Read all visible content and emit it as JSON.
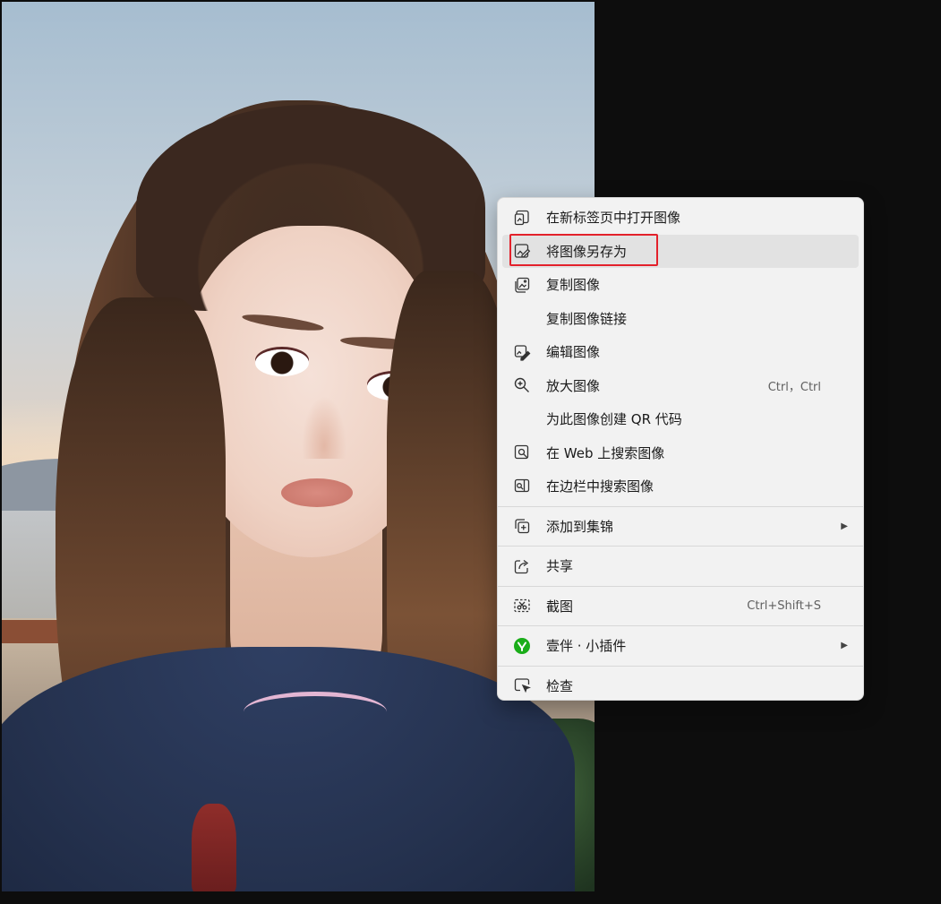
{
  "menu": {
    "items": [
      {
        "label": "在新标签页中打开图像",
        "icon": "open-new-tab-icon",
        "shortcut": "",
        "submenu": false
      },
      {
        "label": "将图像另存为",
        "icon": "save-image-icon",
        "shortcut": "",
        "submenu": false
      },
      {
        "label": "复制图像",
        "icon": "copy-image-icon",
        "shortcut": "",
        "submenu": false
      },
      {
        "label": "复制图像链接",
        "icon": "",
        "shortcut": "",
        "submenu": false
      },
      {
        "label": "编辑图像",
        "icon": "edit-image-icon",
        "shortcut": "",
        "submenu": false
      },
      {
        "label": "放大图像",
        "icon": "zoom-in-icon",
        "shortcut": "Ctrl，Ctrl",
        "submenu": false
      },
      {
        "label": "为此图像创建 QR 代码",
        "icon": "",
        "shortcut": "",
        "submenu": false
      },
      {
        "label": "在 Web 上搜索图像",
        "icon": "web-search-image-icon",
        "shortcut": "",
        "submenu": false
      },
      {
        "label": "在边栏中搜索图像",
        "icon": "sidebar-search-image-icon",
        "shortcut": "",
        "submenu": false
      },
      {
        "label": "添加到集锦",
        "icon": "collections-icon",
        "shortcut": "",
        "submenu": true
      },
      {
        "label": "共享",
        "icon": "share-icon",
        "shortcut": "",
        "submenu": false
      },
      {
        "label": "截图",
        "icon": "screenshot-icon",
        "shortcut": "Ctrl+Shift+S",
        "submenu": false
      },
      {
        "label": "壹伴 · 小插件",
        "icon": "yiban-plugin-icon",
        "shortcut": "",
        "submenu": true
      },
      {
        "label": "检查",
        "icon": "inspect-icon",
        "shortcut": "",
        "submenu": false
      }
    ],
    "hovered_item": "将图像另存为",
    "submenu_arrow": "▶"
  },
  "colors": {
    "menu_background": "#f2f2f2",
    "hover_background": "#e2e2e2",
    "highlight_box": "#e3212b",
    "plugin_icon": "#1aad19",
    "page_background": "#0d0d0d"
  }
}
